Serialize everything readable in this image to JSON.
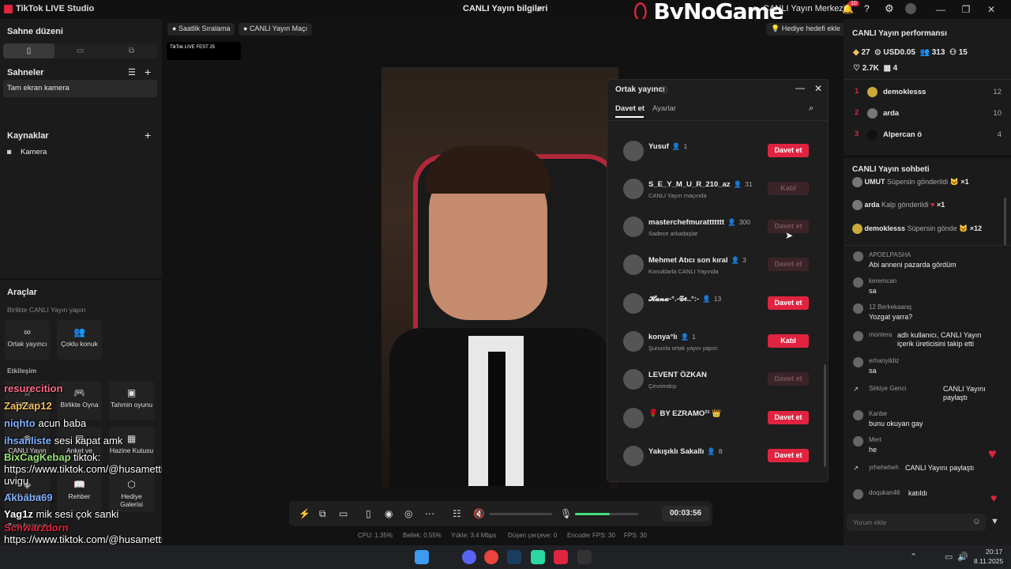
{
  "titlebar": {
    "app_title": "TikTok LIVE Studio",
    "center_title": "CANLI Yayın bilgileri",
    "logo": "ByNoGame",
    "live_center": "CANLI Yayın Merkezi",
    "notif_count": "10",
    "minimize": "—",
    "maximize": "❐",
    "close": "✕"
  },
  "left": {
    "scene_layout": "Sahne düzeni",
    "scenes": "Sahneler",
    "scene_item": "Tam ekran kamera",
    "sources": "Kaynaklar",
    "source_item": "Kamera",
    "tools": "Araçlar",
    "tools_sub": "Birlikte CANLI Yayın yapın",
    "tool_cohost": "Ortak yayıncı",
    "tool_multi": "Çoklu konuk",
    "engagement": "Etkileşim",
    "tool_wishes": "Dilekleri",
    "tool_play": "Birlikte Oyna",
    "tool_guess": "Tahmin oyunu",
    "tool_live": "CANLI Yayın",
    "tool_poll": "Anket ve",
    "tool_treasure": "Hazine Kutusu",
    "tool_gift_cup": "Ödül Çantası",
    "tool_guide": "Rehber",
    "tool_gift_gallery": "Hediye Galerisi",
    "earnings": "Para kazanma"
  },
  "overlay_chat": [
    {
      "user": "resurecition",
      "text": "",
      "color": "#ff6b8b"
    },
    {
      "user": "ZapZap12",
      "text": "",
      "color": "#f5c15d"
    },
    {
      "user": "niqhto",
      "text": "acun baba",
      "color": "#7fb0ff"
    },
    {
      "user": "ihsanliste",
      "text": "sesi kapat amk",
      "color": "#7fb0ff"
    },
    {
      "user": "BixCagKebap",
      "text": "tiktok: https://www.tiktok.com/@husamettinviy uvigu",
      "color": "#9be37a"
    },
    {
      "user": "Akbaba69",
      "text": "",
      "color": "#7fb0ff"
    },
    {
      "user": "Yag1z",
      "text": "mik sesi çok sanki",
      "color": "#ffffff"
    },
    {
      "user": "Schwarzdorn",
      "text": "https://www.tiktok.com/@husamettinviy uvigu",
      "color": "#e0243f"
    }
  ],
  "stage": {
    "pill_ranking": "Saatlik Sıralama",
    "pill_match": "CANLI Yayın Maçı",
    "pill_gift_goal": "Hediye hedefi ekle",
    "fest": "TikTok LIVE FEST 25"
  },
  "cohost": {
    "title": "Ortak yayıncı",
    "tab_invite": "Davet et",
    "tab_settings": "Ayarlar",
    "rows": [
      {
        "name": "Yusuf",
        "count": "1",
        "sub": "",
        "button": "Davet et",
        "state": "red"
      },
      {
        "name": "S_E_Y_M_U_R_210_az",
        "count": "31",
        "sub": "CANLI Yayın maçında",
        "button": "Katıl",
        "state": "dim"
      },
      {
        "name": "masterchefmurattttttt",
        "count": "300",
        "sub": "Sadece arkadaşlar",
        "button": "Davet et",
        "state": "dim"
      },
      {
        "name": "Mehmet Atıcı son kıral",
        "count": "3",
        "sub": "Konuklarla CANLI Yayında",
        "button": "Davet et",
        "state": "dim"
      },
      {
        "name": "𝓗𝓪𝓷𝓪-°.-𝕾𝖊..°:-",
        "count": "13",
        "sub": "",
        "button": "Davet et",
        "state": "red"
      },
      {
        "name": "konya°lı",
        "count": "1",
        "sub": "Şununla ortak yayın yapın:",
        "button": "Katıl",
        "state": "red"
      },
      {
        "name": "LEVENT ÖZKAN",
        "count": "",
        "sub": "Çevrimdışı",
        "button": "Davet et",
        "state": "dim"
      },
      {
        "name": "🌹 BY EZRAMO²¹ 👑",
        "count": "",
        "sub": "",
        "button": "Davet et",
        "state": "red"
      },
      {
        "name": "Yakışıklı Sakallı",
        "count": "8",
        "sub": "",
        "button": "Davet et",
        "state": "red"
      }
    ]
  },
  "controls": {
    "timer": "00:03:56",
    "mic_level": 0.55
  },
  "stats": {
    "cpu": "CPU: 1.35%",
    "mem": "Bellek: 0.55%",
    "upload": "Yükle: 3.4 Mbps",
    "drop": "Düşen çerçeve: 0",
    "encoder": "Encoder FPS: 30",
    "fps": "FPS: 30"
  },
  "right": {
    "perf_title": "CANLI Yayın performansı",
    "diamonds": "27",
    "usd": "USD0.05",
    "viewers": "313",
    "followers": "15",
    "likes": "2.7K",
    "gifts": "4",
    "leaderboard": [
      {
        "rank": "1",
        "name": "demoklesss",
        "value": "12"
      },
      {
        "rank": "2",
        "name": "arda",
        "value": "10"
      },
      {
        "rank": "3",
        "name": "Alpercan ö",
        "value": "4"
      }
    ],
    "chat_title": "CANLI Yayın sohbeti",
    "gifts_feed": [
      {
        "user": "UMUT",
        "action": "Süpersin gönderildi",
        "mult": "×1"
      },
      {
        "user": "arda",
        "action": "Kalp gönderildi",
        "mult": "×1"
      },
      {
        "user": "demoklesss",
        "action": "Süpersin gönde",
        "mult": "×12"
      }
    ],
    "messages": [
      {
        "user": "APOELPASHA",
        "text": "Abi anneni pazarda gördüm"
      },
      {
        "user": "keremcan",
        "text": "sa"
      },
      {
        "user": "12 Berkekaanq",
        "text": "Yozgat yarra?"
      },
      {
        "user": "montera",
        "text": "adlı kullanıcı, CANLI Yayın içerik üreticisini takip etti"
      },
      {
        "user": "erhanyildiz",
        "text": "sa"
      },
      {
        "user": "Sirkiye Genci",
        "text": "CANLI Yayını paylaştı"
      },
      {
        "user": "Kanbe",
        "text": "bunu okuyan gay"
      },
      {
        "user": "Mert",
        "text": "he"
      },
      {
        "user": "yrheheheh",
        "text": "CANLI Yayını paylaştı"
      },
      {
        "user": "doqukan46",
        "text": "katıldı"
      }
    ],
    "comment_placeholder": "Yorum ekle"
  },
  "taskbar": {
    "time": "20:17",
    "date": "8.11.2025"
  }
}
